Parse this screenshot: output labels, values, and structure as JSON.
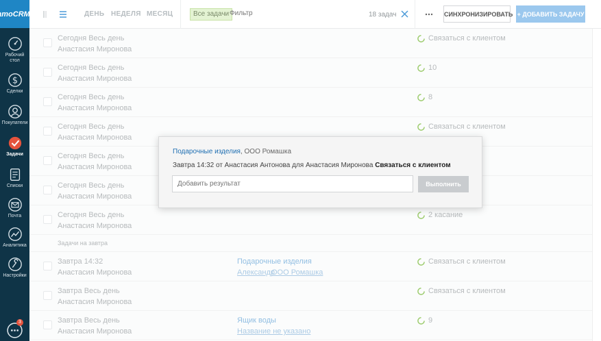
{
  "sidebar": {
    "logo": "amoCRM.",
    "items": [
      {
        "label": "Рабочий стол",
        "icon": "dashboard-icon"
      },
      {
        "label": "Сделки",
        "icon": "dollar-icon"
      },
      {
        "label": "Покупатели",
        "icon": "buyers-icon"
      },
      {
        "label": "Задачи",
        "icon": "tasks-icon",
        "active": true
      },
      {
        "label": "Списки",
        "icon": "lists-icon"
      },
      {
        "label": "Почта",
        "icon": "mail-icon"
      },
      {
        "label": "Аналитика",
        "icon": "analytics-icon"
      },
      {
        "label": "Настройки",
        "icon": "settings-icon"
      }
    ],
    "chat_badge": "3"
  },
  "topbar": {
    "view_tabs": [
      "ДЕНЬ",
      "НЕДЕЛЯ",
      "МЕСЯЦ"
    ],
    "filter_badge": "Все задачи",
    "filter_placeholder": "Фильтр",
    "count": "18 задач",
    "sync_button": "СИНХРОНИЗИРОВАТЬ",
    "add_button": "+ ДОБАВИТЬ ЗАДАЧУ"
  },
  "rows": [
    {
      "when": "Сегодня Весь день",
      "who": "Анастасия Миронова",
      "task": "Связаться с клиентом"
    },
    {
      "when": "Сегодня Весь день",
      "who": "Анастасия Миронова",
      "task": "10"
    },
    {
      "when": "Сегодня Весь день",
      "who": "Анастасия Миронова",
      "task": "8"
    },
    {
      "when": "Сегодня Весь день",
      "who": "Анастасия Миронова",
      "task": "Связаться с клиентом"
    },
    {
      "when": "Сегодня Весь день",
      "who": "Анастасия Миронова",
      "task": ""
    },
    {
      "when": "Сегодня Весь день",
      "who": "Анастасия Миронова",
      "task": ""
    },
    {
      "when": "Сегодня Весь день",
      "who": "Анастасия Миронова",
      "task": "2 касание"
    }
  ],
  "section_tomorrow": "Задачи на завтра",
  "rows_tomorrow": [
    {
      "when": "Завтра 14:32",
      "who": "Анастасия Миронова",
      "entity": "Подарочные изделия",
      "entity_sub_a": "Александр",
      "entity_sub_b": "ООО Ромашка",
      "task": "Связаться с клиентом"
    },
    {
      "when": "Завтра Весь день",
      "who": "Анастасия Миронова",
      "entity": "",
      "entity_sub_a": "",
      "entity_sub_b": "",
      "task": "Связаться с клиентом"
    },
    {
      "when": "Завтра Весь день",
      "who": "Анастасия Миронова",
      "entity": "Ящик воды",
      "entity_sub_a": "Название не указано",
      "entity_sub_b": "",
      "task": "9"
    }
  ],
  "modal": {
    "lead_link": "Подарочные изделия",
    "company": ", ООО Ромашка",
    "meta": "Завтра 14:32 от Анастасия Антонова для Анастасия Миронова",
    "task_type": "Связаться с клиентом",
    "result_placeholder": "Добавить результат",
    "submit": "Выполнить"
  },
  "colors": {
    "sidebar": "#0f3447",
    "accent": "#1f86c5",
    "add_button": "#9bc8ee"
  }
}
